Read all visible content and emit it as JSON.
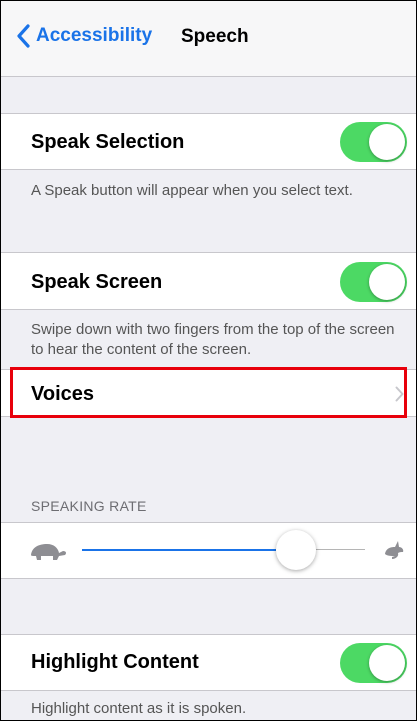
{
  "nav": {
    "back_label": "Accessibility",
    "title": "Speech"
  },
  "speak_selection": {
    "label": "Speak Selection",
    "enabled": true,
    "footer": "A Speak button will appear when you select text."
  },
  "speak_screen": {
    "label": "Speak Screen",
    "enabled": true,
    "footer": "Swipe down with two fingers from the top of the screen to hear the content of the screen."
  },
  "voices": {
    "label": "Voices"
  },
  "speaking_rate": {
    "header": "SPEAKING RATE",
    "value": 0.8
  },
  "highlight_content": {
    "label": "Highlight Content",
    "enabled": true,
    "footer": "Highlight content as it is spoken."
  },
  "colors": {
    "accent": "#1a73e8",
    "toggle_on": "#4cd964",
    "highlight": "#e8000b"
  }
}
